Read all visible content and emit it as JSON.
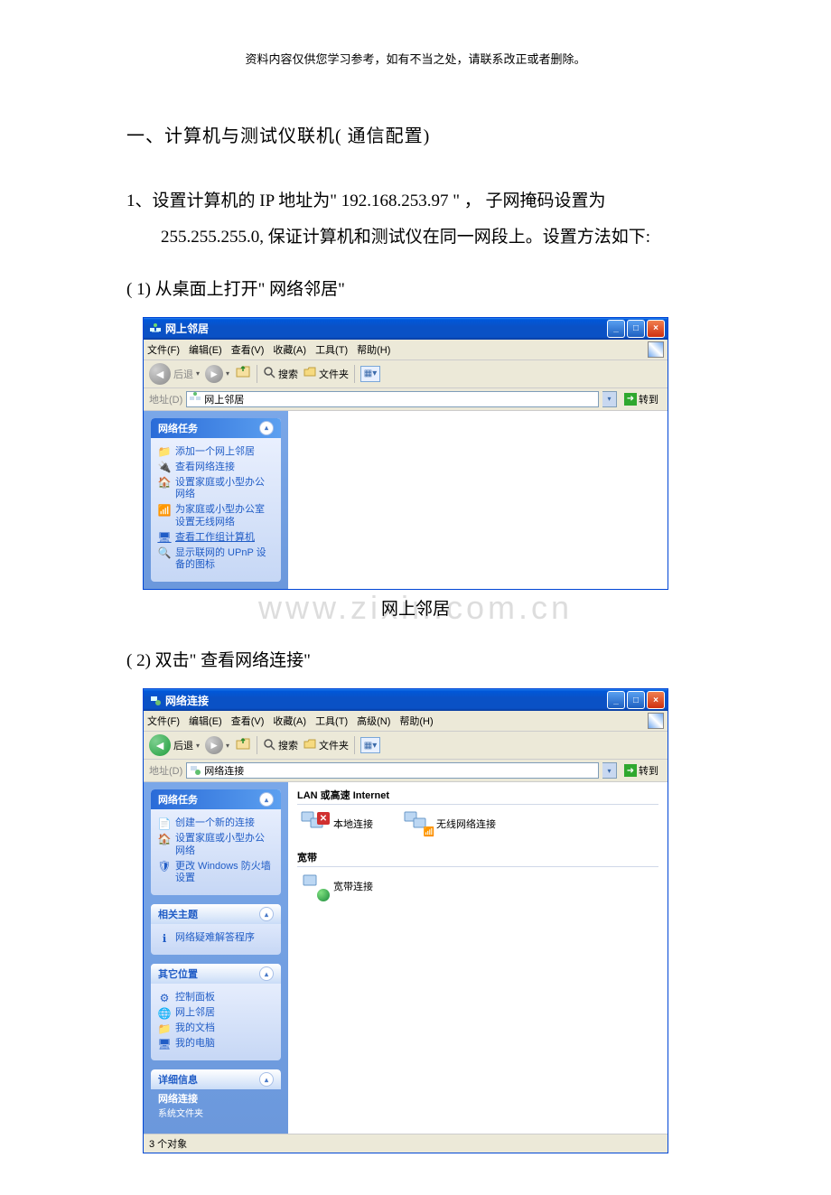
{
  "header_note": "资料内容仅供您学习参考，如有不当之处，请联系改正或者删除。",
  "section_title": "一、计算机与测试仪联机( 通信配置)",
  "para1": "1、设置计算机的 IP 地址为\" 192.168.253.97 \" ， 子网掩码设置为 255.255.255.0, 保证计算机和测试仪在同一网段上。设置方法如下:",
  "sub1": "( 1) 从桌面上打开\" 网络邻居\"",
  "caption1_watermark": "www.zixin.com.cn",
  "caption1": "网上邻居",
  "sub2": "( 2) 双击\" 查看网络连接\"",
  "win1": {
    "title": "网上邻居",
    "menu": {
      "file": "文件(F)",
      "edit": "编辑(E)",
      "view": "查看(V)",
      "fav": "收藏(A)",
      "tools": "工具(T)",
      "help": "帮助(H)"
    },
    "toolbar": {
      "back": "后退",
      "search": "搜索",
      "folders": "文件夹"
    },
    "address": {
      "label": "地址(D)",
      "value": "网上邻居",
      "go": "转到"
    },
    "sidebar": {
      "tasks_header": "网络任务",
      "items": [
        "添加一个网上邻居",
        "查看网络连接",
        "设置家庭或小型办公网络",
        "为家庭或小型办公室设置无线网络",
        "查看工作组计算机",
        "显示联网的 UPnP 设备的图标"
      ]
    }
  },
  "win2": {
    "title": "网络连接",
    "menu": {
      "file": "文件(F)",
      "edit": "编辑(E)",
      "view": "查看(V)",
      "fav": "收藏(A)",
      "tools": "工具(T)",
      "adv": "高级(N)",
      "help": "帮助(H)"
    },
    "toolbar": {
      "back": "后退",
      "search": "搜索",
      "folders": "文件夹"
    },
    "address": {
      "label": "地址(D)",
      "value": "网络连接",
      "go": "转到"
    },
    "sidebar": {
      "tasks_header": "网络任务",
      "tasks": [
        "创建一个新的连接",
        "设置家庭或小型办公网络",
        "更改 Windows 防火墙设置"
      ],
      "related_header": "相关主题",
      "related": [
        "网络疑难解答程序"
      ],
      "other_header": "其它位置",
      "other": [
        "控制面板",
        "网上邻居",
        "我的文档",
        "我的电脑"
      ],
      "details_header": "详细信息",
      "details_title": "网络连接",
      "details_sub": "系统文件夹"
    },
    "content": {
      "section_lan": "LAN 或高速 Internet",
      "local_conn": "本地连接",
      "wireless_conn": "无线网络连接",
      "section_bb": "宽带",
      "bb_conn": "宽带连接"
    },
    "status": "3 个对象"
  }
}
